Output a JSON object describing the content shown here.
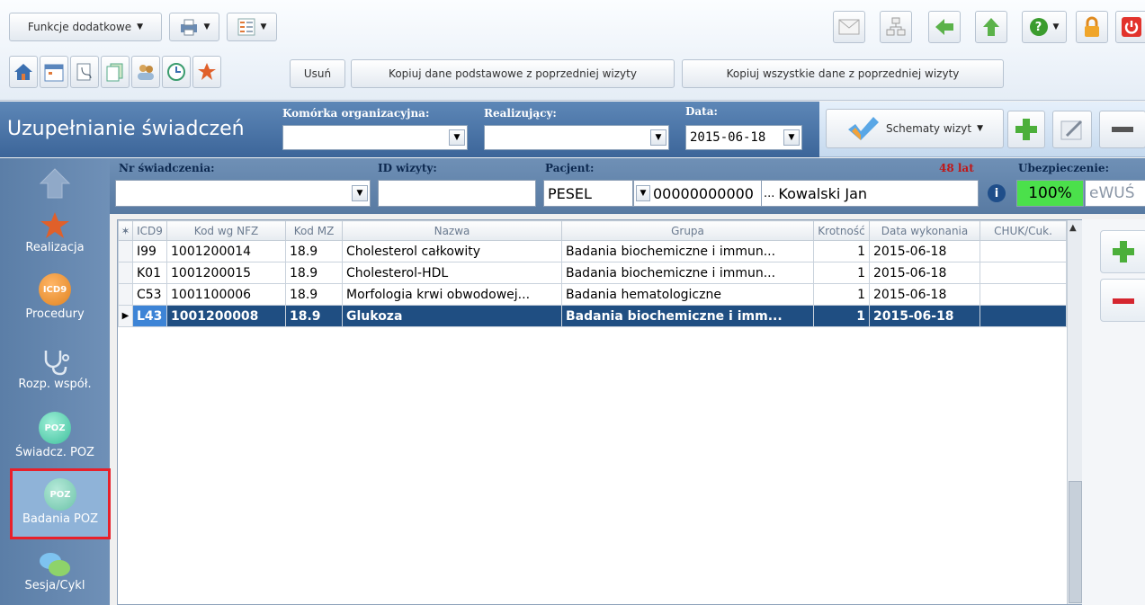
{
  "toolbar": {
    "funkcje_label": "Funkcje dodatkowe",
    "usun_label": "Usuń",
    "kopiuj_podst_label": "Kopiuj dane podstawowe z poprzedniej wizyty",
    "kopiuj_wszystkie_label": "Kopiuj wszystkie dane z poprzedniej wizyty"
  },
  "header": {
    "title": "Uzupełnianie świadczeń",
    "komorka_label": "Komórka organizacyjna:",
    "komorka_value": "",
    "realizujacy_label": "Realizujący:",
    "realizujacy_value": "",
    "data_label": "Data:",
    "data_value": "2015-06-18",
    "schematy_label": "Schematy wizyt"
  },
  "patient": {
    "nr_label": "Nr świadczenia:",
    "nr_value": "",
    "id_label": "ID wizyty:",
    "id_value": "",
    "pacjent_label": "Pacjent:",
    "id_type": "PESEL",
    "pesel": "00000000000",
    "ellipsis": "...",
    "name": "Kowalski Jan",
    "age": "48 lat",
    "ubezp_label": "Ubezpieczenie:",
    "ubezp_value": "100%",
    "ewus": "eWUŚ"
  },
  "nav": {
    "items": [
      {
        "label": ""
      },
      {
        "label": "Realizacja"
      },
      {
        "label": "Procedury",
        "badge": "ICD9"
      },
      {
        "label": "Rozp. współ."
      },
      {
        "label": "Świadcz. POZ",
        "badge": "POZ"
      },
      {
        "label": "Badania POZ",
        "badge": "POZ"
      },
      {
        "label": "Sesja/Cykl"
      }
    ]
  },
  "grid": {
    "columns": [
      "ICD9",
      "Kod wg NFZ",
      "Kod MZ",
      "Nazwa",
      "Grupa",
      "Krotność",
      "Data wykonania",
      "CHUK/Cuk."
    ],
    "rows": [
      {
        "icd9": "I99",
        "kod_nfz": "1001200014",
        "kod_mz": "18.9",
        "nazwa": "Cholesterol całkowity",
        "grupa": "Badania biochemiczne i immun...",
        "krotnosc": "1",
        "data": "2015-06-18",
        "chuk": ""
      },
      {
        "icd9": "K01",
        "kod_nfz": "1001200015",
        "kod_mz": "18.9",
        "nazwa": "Cholesterol-HDL",
        "grupa": "Badania biochemiczne i immun...",
        "krotnosc": "1",
        "data": "2015-06-18",
        "chuk": ""
      },
      {
        "icd9": "C53",
        "kod_nfz": "1001100006",
        "kod_mz": "18.9",
        "nazwa": "Morfologia krwi obwodowej...",
        "grupa": "Badania hematologiczne",
        "krotnosc": "1",
        "data": "2015-06-18",
        "chuk": ""
      },
      {
        "icd9": "L43",
        "kod_nfz": "1001200008",
        "kod_mz": "18.9",
        "nazwa": "Glukoza",
        "grupa": "Badania biochemiczne i imm...",
        "krotnosc": "1",
        "data": "2015-06-18",
        "chuk": ""
      }
    ]
  },
  "colors": {
    "selected_row": "#1f4e82",
    "highlight_border": "#e8202a",
    "ubezp_bg": "#4be04b"
  }
}
